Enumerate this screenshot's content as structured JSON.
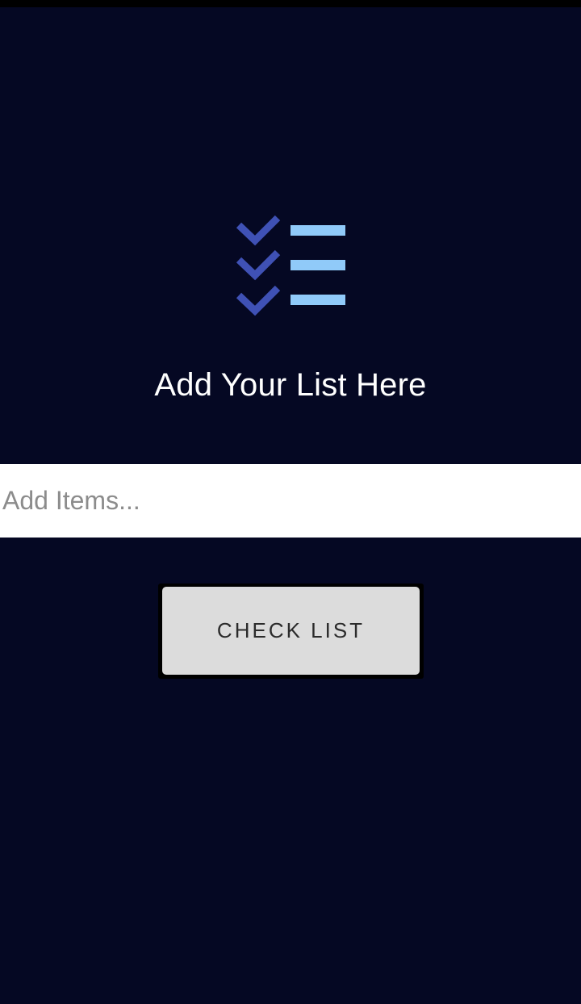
{
  "app": {
    "title": "Add Your List Here",
    "logo_icon": "checklist-icon"
  },
  "form": {
    "input_placeholder": "Add Items...",
    "input_value": "",
    "button_label": "CHECK LIST"
  },
  "colors": {
    "background": "#050823",
    "check_color": "#3f51b5",
    "line_color": "#90caf9",
    "button_bg": "#dcdcdc",
    "title_text": "#ffffff"
  }
}
